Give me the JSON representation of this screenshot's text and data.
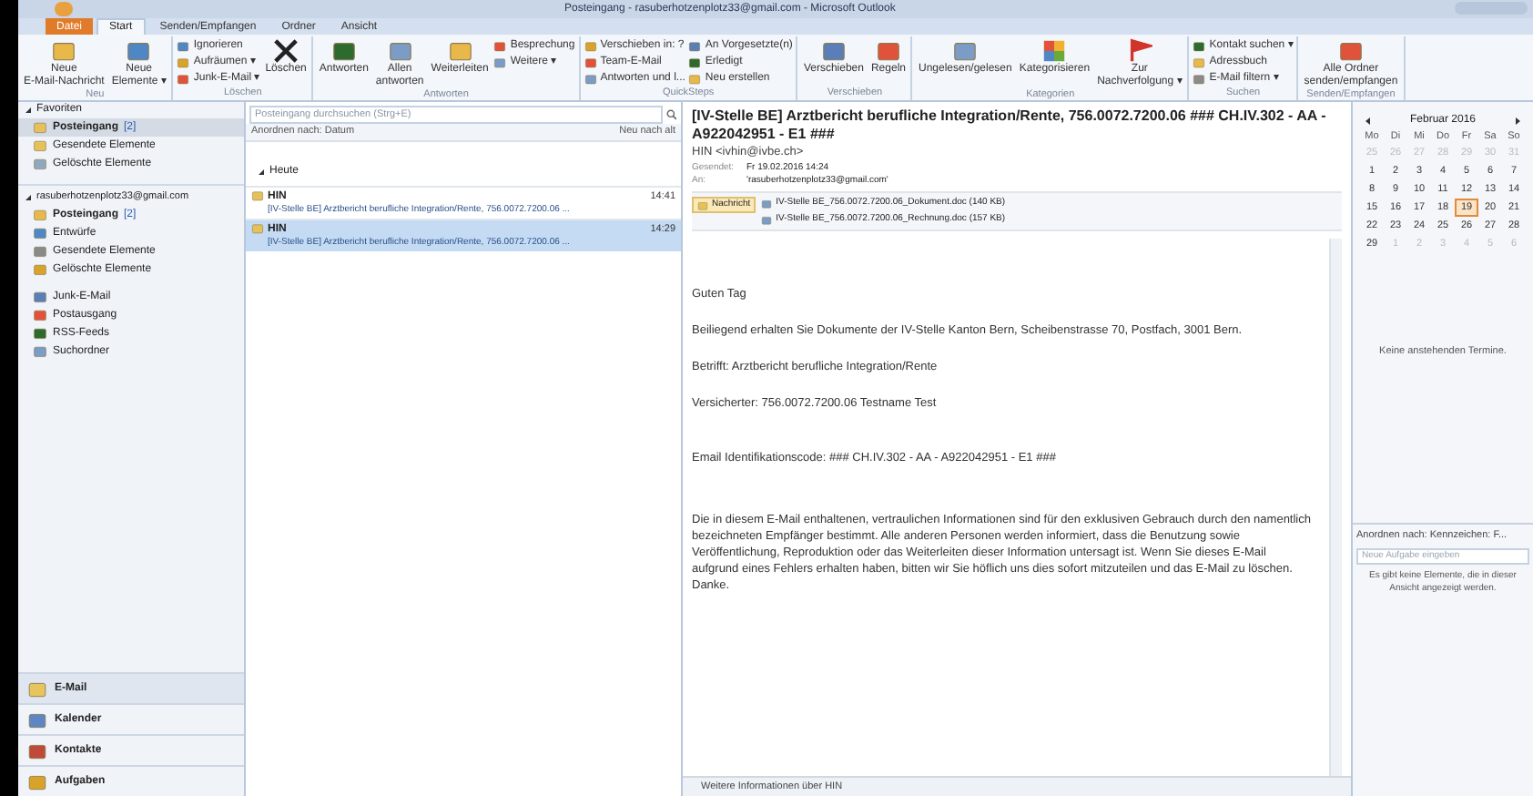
{
  "window": {
    "title": "Posteingang - rasuberhotzenplotz33@gmail.com - Microsoft Outlook"
  },
  "ribbon_tabs": [
    {
      "label": "Datei",
      "kind": "file",
      "selected": false
    },
    {
      "label": "Start",
      "kind": "tab",
      "selected": true
    },
    {
      "label": "Senden/Empfangen",
      "kind": "tab",
      "selected": false
    },
    {
      "label": "Ordner",
      "kind": "tab",
      "selected": false
    },
    {
      "label": "Ansicht",
      "kind": "tab",
      "selected": false
    }
  ],
  "ribbon_groups": [
    {
      "label": "Neu",
      "items": [
        {
          "kind": "large",
          "lines": [
            "Neue",
            "E-Mail-Nachricht"
          ]
        },
        {
          "kind": "large",
          "lines": [
            "Neue",
            "Elemente ▾"
          ]
        }
      ]
    },
    {
      "label": "Löschen",
      "items": [
        {
          "kind": "stack",
          "rows": [
            "Ignorieren",
            "Aufräumen ▾",
            "Junk-E-Mail ▾"
          ]
        },
        {
          "kind": "large",
          "lines": [
            "Löschen"
          ]
        }
      ]
    },
    {
      "label": "Antworten",
      "items": [
        {
          "kind": "large",
          "lines": [
            "Antworten"
          ]
        },
        {
          "kind": "large",
          "lines": [
            "Allen",
            "antworten"
          ]
        },
        {
          "kind": "large",
          "lines": [
            "Weiterleiten"
          ]
        },
        {
          "kind": "stack",
          "rows": [
            "Besprechung",
            "Weitere ▾"
          ]
        }
      ]
    },
    {
      "label": "QuickSteps",
      "items": [
        {
          "kind": "stack",
          "rows": [
            "Verschieben in: ?",
            "Team-E-Mail",
            "Antworten und l..."
          ]
        },
        {
          "kind": "stack",
          "rows": [
            "An Vorgesetzte(n)",
            "Erledigt",
            "Neu erstellen"
          ]
        }
      ]
    },
    {
      "label": "Verschieben",
      "items": [
        {
          "kind": "large",
          "lines": [
            "Verschieben"
          ]
        },
        {
          "kind": "large",
          "lines": [
            "Regeln"
          ]
        }
      ]
    },
    {
      "label": "Kategorien",
      "items": [
        {
          "kind": "large",
          "lines": [
            "Ungelesen/gelesen"
          ]
        },
        {
          "kind": "large",
          "lines": [
            "Kategorisieren"
          ]
        },
        {
          "kind": "large",
          "lines": [
            "Zur",
            "Nachverfolgung ▾"
          ]
        }
      ]
    },
    {
      "label": "Suchen",
      "items": [
        {
          "kind": "stack",
          "rows": [
            "Kontakt suchen ▾",
            "Adressbuch",
            "E-Mail filtern ▾"
          ]
        }
      ]
    },
    {
      "label": "Senden/Empfangen",
      "items": [
        {
          "kind": "large",
          "lines": [
            "Alle Ordner",
            "senden/empfangen"
          ]
        }
      ]
    }
  ],
  "navigation": {
    "favorites_label": "Favoriten",
    "favorites": [
      {
        "label": "Posteingang",
        "count": "[2]",
        "selected": true
      },
      {
        "label": "Gesendete Elemente",
        "selected": false
      },
      {
        "label": "Gelöschte Elemente",
        "selected": false
      }
    ],
    "account_label": "rasuberhotzenplotz33@gmail.com",
    "folder_groups": [
      [
        {
          "label": "Posteingang",
          "count": "[2]",
          "selected": false
        },
        {
          "label": "Entwürfe",
          "selected": false
        },
        {
          "label": "Gesendete Elemente",
          "selected": false
        },
        {
          "label": "Gelöschte Elemente",
          "selected": false
        }
      ],
      [
        {
          "label": "Junk-E-Mail",
          "selected": false
        },
        {
          "label": "Postausgang",
          "selected": false
        },
        {
          "label": "RSS-Feeds",
          "selected": false
        },
        {
          "label": "Suchordner",
          "selected": false
        }
      ]
    ],
    "modules": [
      {
        "label": "E-Mail",
        "selected": true
      },
      {
        "label": "Kalender",
        "selected": false
      },
      {
        "label": "Kontakte",
        "selected": false
      },
      {
        "label": "Aufgaben",
        "selected": false
      }
    ]
  },
  "message_list": {
    "search": {
      "placeholder": "Posteingang durchsuchen (Strg+E)"
    },
    "sort_label": "Anordnen nach: Datum",
    "order_label": "Neu nach alt",
    "group_label": "Heute",
    "messages": [
      {
        "from": "HIN",
        "subject": "[IV-Stelle BE]  Arztbericht berufliche Integration/Rente, 756.0072.7200.06 ...",
        "time": "14:41",
        "selected": false
      },
      {
        "from": "HIN",
        "subject": "[IV-Stelle BE]  Arztbericht berufliche Integration/Rente, 756.0072.7200.06 ...",
        "time": "14:29",
        "selected": true
      }
    ]
  },
  "reading_pane": {
    "subject": "[IV-Stelle BE]  Arztbericht berufliche Integration/Rente, 756.0072.7200.06 ### CH.IV.302 - AA - A922042951 - E1 ###",
    "sender": "HIN <ivhin@ivbe.ch>",
    "sent_label": "Gesendet:",
    "sent": "Fr 19.02.2016 14:24",
    "to_label": "An:",
    "to": "'rasuberhotzenplotz33@gmail.com'",
    "attachments": [
      {
        "label": "Nachricht",
        "kind": "message",
        "selected": true
      },
      {
        "label": "IV-Stelle BE_756.0072.7200.06_Dokument.doc (140 KB)",
        "kind": "file",
        "selected": false
      },
      {
        "label": "IV-Stelle BE_756.0072.7200.06_Rechnung.doc (157 KB)",
        "kind": "file",
        "selected": false
      }
    ],
    "body": [
      "Guten Tag",
      "Beiliegend erhalten Sie Dokumente der IV-Stelle Kanton Bern, Scheibenstrasse 70, Postfach, 3001 Bern.",
      "Betrifft: Arztbericht berufliche Integration/Rente",
      "Versicherter: 756.0072.7200.06  Testname  Test",
      "Email Identifikationscode: ### CH.IV.302 - AA - A922042951 - E1 ###",
      "Die in diesem E-Mail enthaltenen, vertraulichen Informationen sind für den exklusiven Gebrauch durch den namentlich bezeichneten Empfänger bestimmt. Alle anderen Personen werden informiert, dass die Benutzung sowie Veröffentlichung, Reproduktion oder das Weiterleiten dieser Information untersagt ist. Wenn Sie dieses E-Mail aufgrund eines Fehlers erhalten haben, bitten wir Sie höflich uns dies sofort mitzuteilen und das E-Mail zu löschen. Danke."
    ],
    "people_pane": "Weitere Informationen über HIN"
  },
  "todo_bar": {
    "month": "Februar 2016",
    "weekdays": [
      "Mo",
      "Di",
      "Mi",
      "Do",
      "Fr",
      "Sa",
      "So"
    ],
    "weeks": [
      [
        {
          "t": "25",
          "other": true,
          "selected": false
        },
        {
          "t": "26",
          "other": true,
          "selected": false
        },
        {
          "t": "27",
          "other": true,
          "selected": false
        },
        {
          "t": "28",
          "other": true,
          "selected": false
        },
        {
          "t": "29",
          "other": true,
          "selected": false
        },
        {
          "t": "30",
          "other": true,
          "selected": false
        },
        {
          "t": "31",
          "other": true,
          "selected": false
        }
      ],
      [
        {
          "t": "1",
          "other": false,
          "selected": false
        },
        {
          "t": "2",
          "other": false,
          "selected": false
        },
        {
          "t": "3",
          "other": false,
          "selected": false
        },
        {
          "t": "4",
          "other": false,
          "selected": false
        },
        {
          "t": "5",
          "other": false,
          "selected": false
        },
        {
          "t": "6",
          "other": false,
          "selected": false
        },
        {
          "t": "7",
          "other": false,
          "selected": false
        }
      ],
      [
        {
          "t": "8",
          "other": false,
          "selected": false
        },
        {
          "t": "9",
          "other": false,
          "selected": false
        },
        {
          "t": "10",
          "other": false,
          "selected": false
        },
        {
          "t": "11",
          "other": false,
          "selected": false
        },
        {
          "t": "12",
          "other": false,
          "selected": false
        },
        {
          "t": "13",
          "other": false,
          "selected": false
        },
        {
          "t": "14",
          "other": false,
          "selected": false
        }
      ],
      [
        {
          "t": "15",
          "other": false,
          "selected": false
        },
        {
          "t": "16",
          "other": false,
          "selected": false
        },
        {
          "t": "17",
          "other": false,
          "selected": false
        },
        {
          "t": "18",
          "other": false,
          "selected": false
        },
        {
          "t": "19",
          "other": false,
          "selected": true
        },
        {
          "t": "20",
          "other": false,
          "selected": false
        },
        {
          "t": "21",
          "other": false,
          "selected": false
        }
      ],
      [
        {
          "t": "22",
          "other": false,
          "selected": false
        },
        {
          "t": "23",
          "other": false,
          "selected": false
        },
        {
          "t": "24",
          "other": false,
          "selected": false
        },
        {
          "t": "25",
          "other": false,
          "selected": false
        },
        {
          "t": "26",
          "other": false,
          "selected": false
        },
        {
          "t": "27",
          "other": false,
          "selected": false
        },
        {
          "t": "28",
          "other": false,
          "selected": false
        }
      ],
      [
        {
          "t": "29",
          "other": false,
          "selected": false
        },
        {
          "t": "1",
          "other": true,
          "selected": false
        },
        {
          "t": "2",
          "other": true,
          "selected": false
        },
        {
          "t": "3",
          "other": true,
          "selected": false
        },
        {
          "t": "4",
          "other": true,
          "selected": false
        },
        {
          "t": "5",
          "other": true,
          "selected": false
        },
        {
          "t": "6",
          "other": true,
          "selected": false
        }
      ]
    ],
    "appointments_empty": "Keine anstehenden Termine.",
    "tasks_sort": "Anordnen nach: Kennzeichen: F...",
    "task_input": {
      "placeholder": "Neue Aufgabe eingeben"
    },
    "tasks_empty": "Es gibt keine Elemente, die in dieser Ansicht angezeigt werden."
  }
}
